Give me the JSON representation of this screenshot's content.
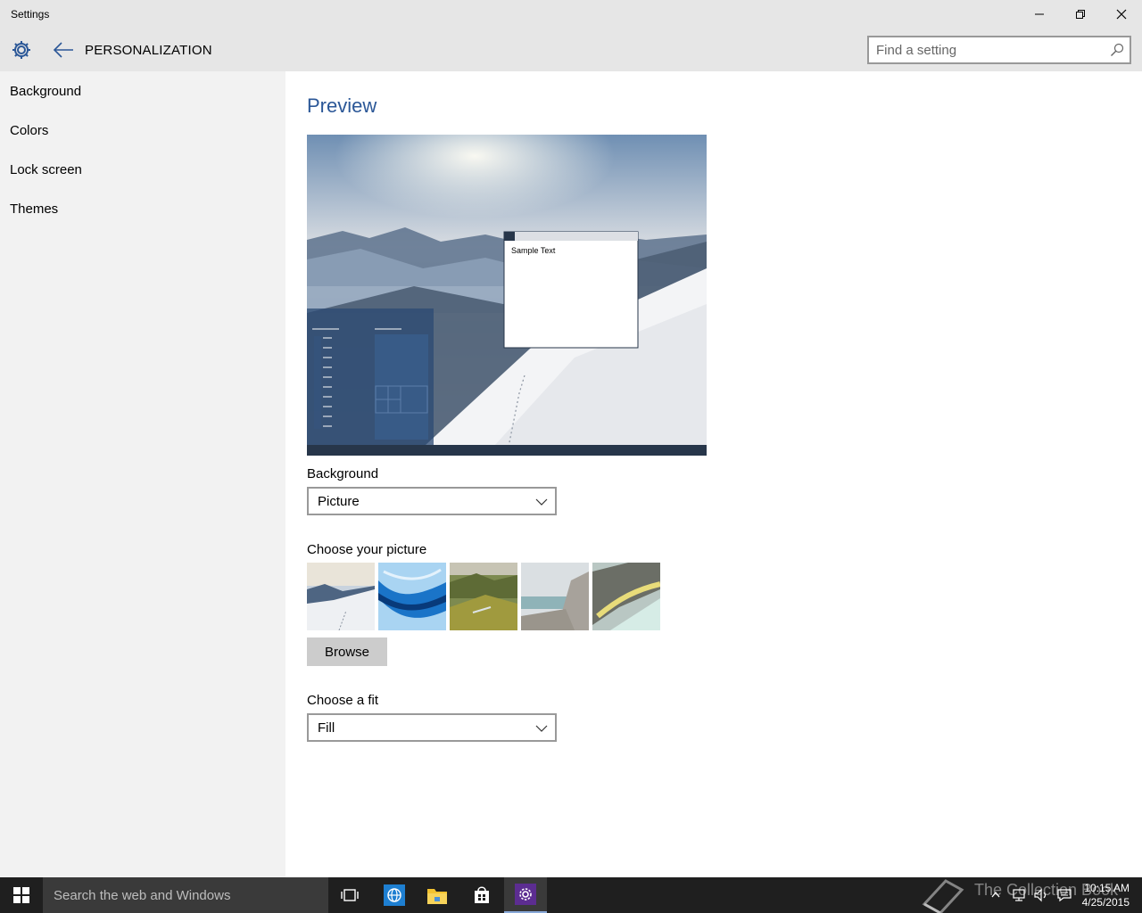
{
  "window": {
    "title": "Settings",
    "minimize_icon": "minimize-icon",
    "maximize_icon": "restore-icon",
    "close_icon": "close-icon"
  },
  "header": {
    "page_title": "PERSONALIZATION",
    "search_placeholder": "Find a setting"
  },
  "sidebar": {
    "items": [
      {
        "label": "Background"
      },
      {
        "label": "Colors"
      },
      {
        "label": "Lock screen"
      },
      {
        "label": "Themes"
      }
    ]
  },
  "main": {
    "preview_heading": "Preview",
    "sample_text": "Sample Text",
    "background_label": "Background",
    "background_value": "Picture",
    "choose_picture_label": "Choose your picture",
    "browse_label": "Browse",
    "fit_label": "Choose a fit",
    "fit_value": "Fill"
  },
  "taskbar": {
    "search_placeholder": "Search the web and Windows",
    "watermark": "The Collection Book",
    "time": "10:15 AM",
    "date": "4/25/2015"
  },
  "colors": {
    "accent": "#2b5797",
    "sidebar_bg": "#f2f2f2",
    "titlebar_bg": "#e6e6e6",
    "taskbar_bg": "#1f1f1f"
  }
}
